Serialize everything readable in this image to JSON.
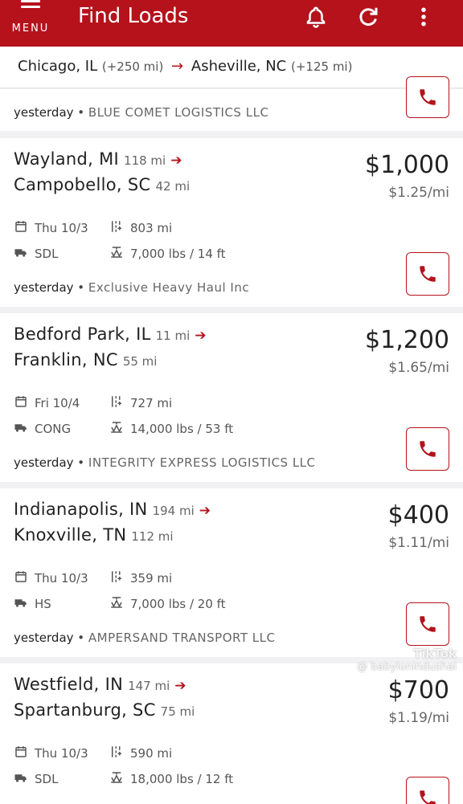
{
  "header": {
    "menu_label": "MENU",
    "title": "Find Loads",
    "icons": [
      "menu-icon",
      "bell-icon",
      "refresh-icon",
      "more-vert-icon"
    ]
  },
  "route": {
    "origin": "Chicago, IL",
    "origin_radius": "(+250 mi)",
    "destination": "Asheville, NC",
    "destination_radius": "(+125 mi)"
  },
  "partial_card": {
    "posted": "yesterday",
    "company": "BLUE COMET LOGISTICS LLC"
  },
  "loads": [
    {
      "origin": "Wayland, MI",
      "origin_dh": "118 mi",
      "dest": "Campobello, SC",
      "dest_dh": "42 mi",
      "price": "$1,000",
      "rate": "$1.25/mi",
      "date": "Thu 10/3",
      "distance": "803 mi",
      "equipment": "SDL",
      "weight_length": "7,000 lbs / 14 ft",
      "posted": "yesterday",
      "company": "Exclusive Heavy Haul Inc"
    },
    {
      "origin": "Bedford Park, IL",
      "origin_dh": "11 mi",
      "dest": "Franklin, NC",
      "dest_dh": "55 mi",
      "price": "$1,200",
      "rate": "$1.65/mi",
      "date": "Fri 10/4",
      "distance": "727 mi",
      "equipment": "CONG",
      "weight_length": "14,000 lbs / 53 ft",
      "posted": "yesterday",
      "company": "INTEGRITY EXPRESS LOGISTICS LLC"
    },
    {
      "origin": "Indianapolis, IN",
      "origin_dh": "194 mi",
      "dest": "Knoxville, TN",
      "dest_dh": "112 mi",
      "price": "$400",
      "rate": "$1.11/mi",
      "date": "Thu 10/3",
      "distance": "359 mi",
      "equipment": "HS",
      "weight_length": "7,000 lbs / 20 ft",
      "posted": "yesterday",
      "company": "AMPERSAND TRANSPORT LLC"
    },
    {
      "origin": "Westfield, IN",
      "origin_dh": "147 mi",
      "dest": "Spartanburg, SC",
      "dest_dh": "75 mi",
      "price": "$700",
      "rate": "$1.19/mi",
      "date": "Thu 10/3",
      "distance": "590 mi",
      "equipment": "SDL",
      "weight_length": "18,000 lbs / 12 ft"
    }
  ],
  "watermark": {
    "brand": "TikTok",
    "handle": "@ babylonindushai"
  },
  "colors": {
    "accent": "#b5121b",
    "background": "#f1f1f3",
    "card": "#ffffff"
  }
}
